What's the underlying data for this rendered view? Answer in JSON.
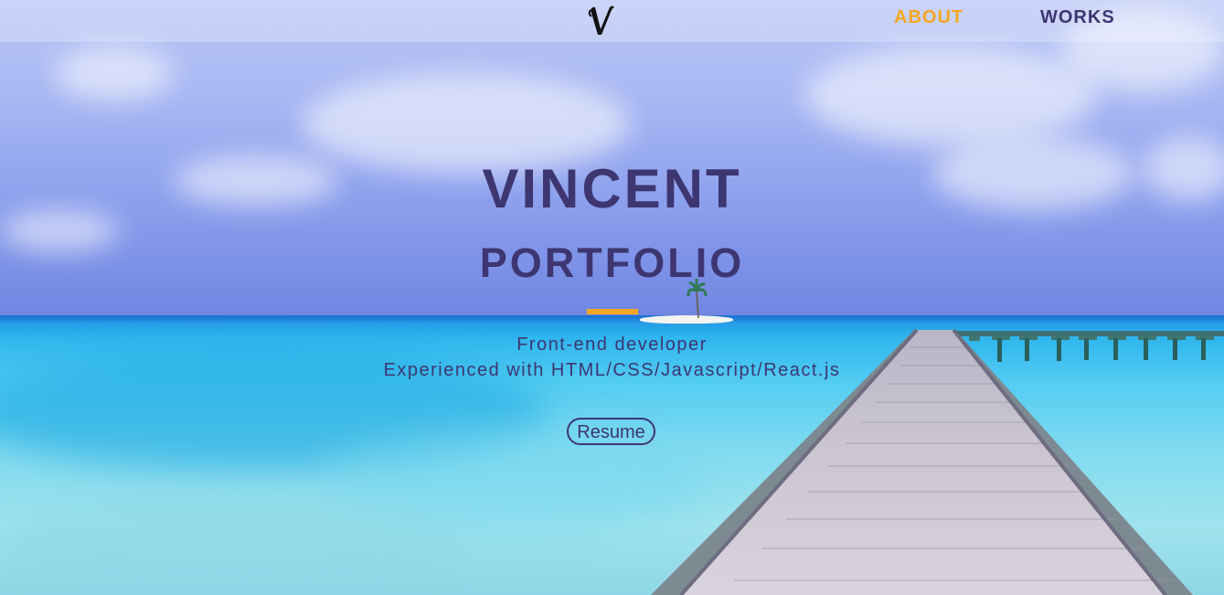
{
  "header": {
    "logo_letter": "V",
    "nav": {
      "about_label": "ABOUT",
      "works_label": "WORKS"
    },
    "active_item": "ABOUT"
  },
  "hero": {
    "title": "VINCENT",
    "subtitle": "PORTFOLIO",
    "tagline_line1": "Front-end developer",
    "tagline_line2": "Experienced with HTML/CSS/Javascript/React.js",
    "resume_label": "Resume"
  },
  "colors": {
    "primary_text": "#3d3670",
    "accent": "#f5a623"
  },
  "icons": {
    "logo": "v-letter-logo"
  }
}
